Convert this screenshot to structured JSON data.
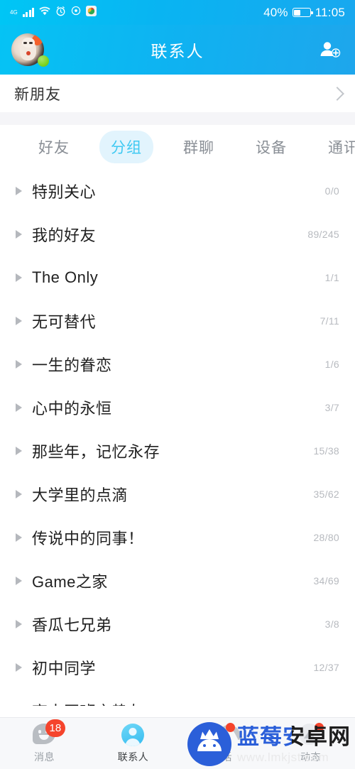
{
  "status_bar": {
    "network": "4G",
    "icons": [
      "signal-bars-icon",
      "wifi-icon",
      "alarm-clock-icon",
      "circle-icon",
      "app-icon"
    ],
    "battery_percent": "40%",
    "time": "11:05"
  },
  "header": {
    "title": "联系人",
    "avatar_name": "user-avatar",
    "online_status": "online",
    "add_friend_label": "add-friend"
  },
  "new_friend": {
    "label": "新朋友"
  },
  "tabs": [
    {
      "label": "好友",
      "active": false
    },
    {
      "label": "分组",
      "active": true
    },
    {
      "label": "群聊",
      "active": false
    },
    {
      "label": "设备",
      "active": false
    },
    {
      "label": "通讯录",
      "active": false
    }
  ],
  "groups": [
    {
      "name": "特别关心",
      "count": "0/0"
    },
    {
      "name": "我的好友",
      "count": "89/245"
    },
    {
      "name": "The Only",
      "count": "1/1"
    },
    {
      "name": "无可替代",
      "count": "7/11"
    },
    {
      "name": "一生的眷恋",
      "count": "1/6"
    },
    {
      "name": "心中的永恒",
      "count": "3/7"
    },
    {
      "name": "那些年，记忆永存",
      "count": "15/38"
    },
    {
      "name": "大学里的点滴",
      "count": "35/62"
    },
    {
      "name": "传说中的同事！",
      "count": "28/80"
    },
    {
      "name": "Game之家",
      "count": "34/69"
    },
    {
      "name": "香瓜七兄弟",
      "count": "3/8"
    },
    {
      "name": "初中同学",
      "count": "12/37"
    },
    {
      "name": "高中同班之挚友",
      "count": ""
    }
  ],
  "bottom_nav": [
    {
      "label": "消息",
      "icon": "chat-bubble-icon",
      "badge": "18",
      "active": false
    },
    {
      "label": "联系人",
      "icon": "person-circle-icon",
      "badge": "",
      "active": true
    },
    {
      "label": "电话",
      "icon": "phone-icon",
      "badge": "dot",
      "active": false
    },
    {
      "label": "动态",
      "icon": "dynamic-icon",
      "badge": "dot",
      "active": false
    }
  ],
  "watermark": {
    "title": "蓝莓安卓网",
    "url": "www.lmkjst.com"
  },
  "colors": {
    "header_start": "#05c3f4",
    "header_end": "#1ea6ec",
    "active_tab_bg": "#e2f4fd",
    "active_tab_text": "#3fc9f2",
    "badge_red": "#f5442c",
    "online_green": "#7ed321"
  }
}
